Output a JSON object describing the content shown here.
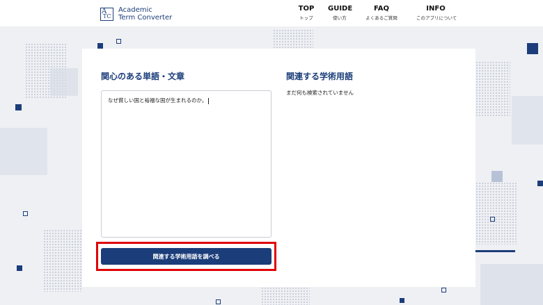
{
  "header": {
    "logo": {
      "line1": "Academic",
      "line2": "Term Converter",
      "mark_top": "A",
      "mark_bottom": "TC"
    },
    "nav": [
      {
        "en": "TOP",
        "ja": "トップ"
      },
      {
        "en": "GUIDE",
        "ja": "使い方"
      },
      {
        "en": "FAQ",
        "ja": "よくあるご質問"
      },
      {
        "en": "INFO",
        "ja": "このアプリについて"
      }
    ]
  },
  "input_panel": {
    "title": "関心のある単語・文章",
    "textarea_value": "なぜ貧しい国と裕福な国が生まれるのか。",
    "button_label": "関連する学術用語を調べる"
  },
  "result_panel": {
    "title": "関連する学術用語",
    "empty_message": "まだ何も検索されていません"
  },
  "colors": {
    "brand": "#1b3d7a",
    "highlight": "#e00000",
    "background": "#eef0f4"
  }
}
